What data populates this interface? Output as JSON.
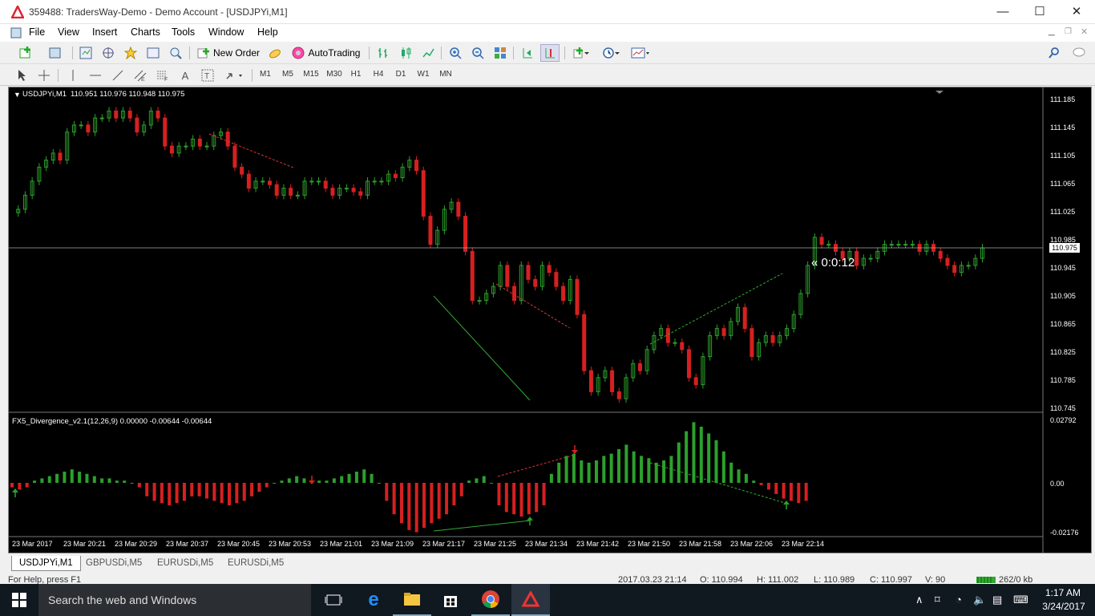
{
  "window": {
    "title": "359488: TradersWay-Demo - Demo Account - [USDJPYi,M1]",
    "minimize": "—",
    "maximize": "☐",
    "close": "✕"
  },
  "menu": [
    "File",
    "View",
    "Insert",
    "Charts",
    "Tools",
    "Window",
    "Help"
  ],
  "toolbar": {
    "new_order": "New Order",
    "autotrading": "AutoTrading"
  },
  "timeframes": [
    "M1",
    "M5",
    "M15",
    "M30",
    "H1",
    "H4",
    "D1",
    "W1",
    "MN"
  ],
  "chart": {
    "symbol_label": "USDJPYi,M1",
    "ohlc": "110.951 110.976 110.948 110.975",
    "price_ticks": [
      "111.185",
      "111.145",
      "111.105",
      "111.065",
      "111.025",
      "110.985",
      "110.945",
      "110.905",
      "110.865",
      "110.825",
      "110.785",
      "110.745"
    ],
    "current_price": "110.975",
    "timer": "« 0:0:12",
    "indicator_label": "FX5_Divergence_v2.1(12,26,9) 0.00000 -0.00644 -0.00644",
    "indicator_ticks": [
      "0.02792",
      "0.00",
      "-0.02176"
    ],
    "time_ticks": [
      "23 Mar 2017",
      "23 Mar 20:21",
      "23 Mar 20:29",
      "23 Mar 20:37",
      "23 Mar 20:45",
      "23 Mar 20:53",
      "23 Mar 21:01",
      "23 Mar 21:09",
      "23 Mar 21:17",
      "23 Mar 21:25",
      "23 Mar 21:34",
      "23 Mar 21:42",
      "23 Mar 21:50",
      "23 Mar 21:58",
      "23 Mar 22:06",
      "23 Mar 22:14"
    ],
    "colors": {
      "bull": "#2ca02c",
      "bear": "#d62020",
      "background": "#000000",
      "grid_text": "#ffffff"
    }
  },
  "tabs": [
    "USDJPYi,M1",
    "GBPUSDi,M5",
    "EURUSDi,M5",
    "EURUSDi,M5"
  ],
  "status": {
    "help": "For Help, press F1",
    "datetime": "2017.03.23 21:14",
    "open": "O: 110.994",
    "high": "H: 111.002",
    "low": "L: 110.989",
    "close": "C: 110.997",
    "volume": "V: 90",
    "traffic": "262/0 kb"
  },
  "taskbar": {
    "search_placeholder": "Search the web and Windows",
    "time": "1:17 AM",
    "date": "3/24/2017"
  }
}
